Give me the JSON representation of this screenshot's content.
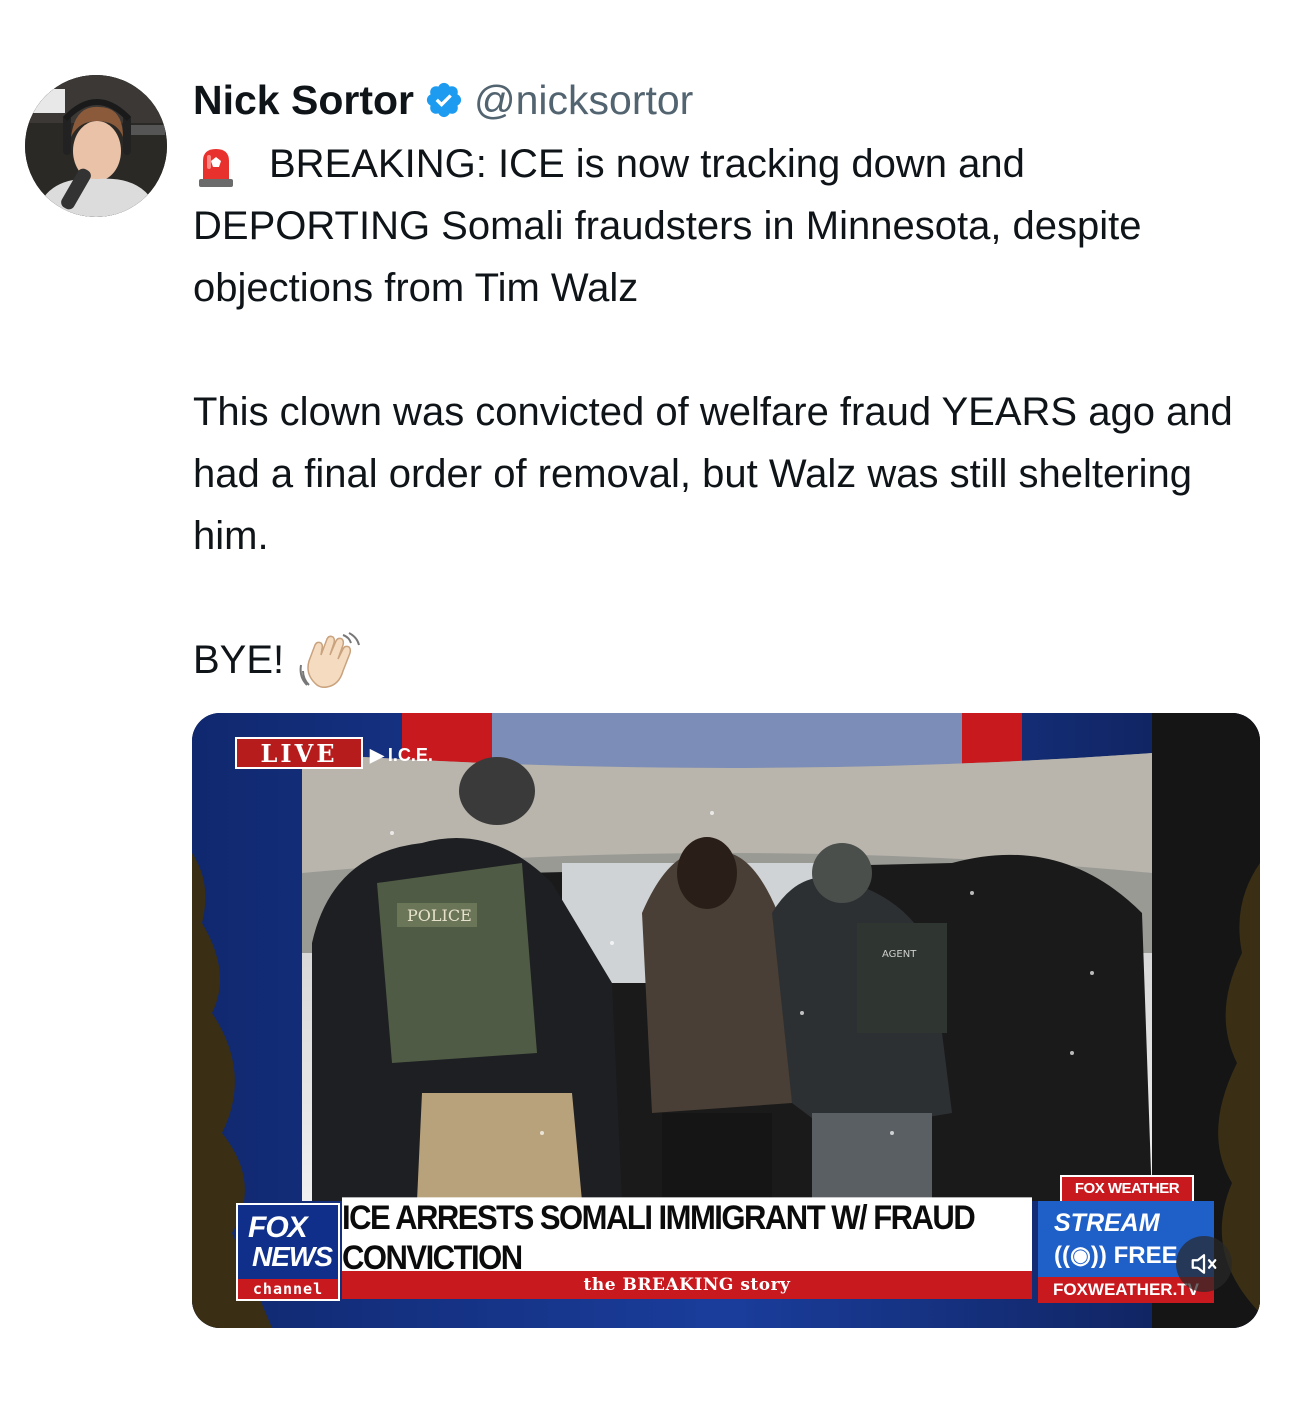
{
  "tweet": {
    "author_name": "Nick Sortor",
    "author_handle": "@nicksortor",
    "lines": [
      "BREAKING: ICE is now tracking down and DEPORTING Somali fraudsters in Minnesota, despite objections from Tim Walz",
      "This clown was convicted of welfare fraud YEARS ago and had a final order of removal, but Walz was still sheltering him.",
      "BYE!"
    ]
  },
  "video": {
    "live_label": "LIVE",
    "tag_label": "I.C.E.",
    "vest_police": "POLICE",
    "vest_agent": "AGENT",
    "chyron": "ICE ARRESTS SOMALI IMMIGRANT W/ FRAUD CONVICTION",
    "subbar": "the BREAKING story",
    "logo_fox": "FOX",
    "logo_news": "NEWS",
    "logo_channel": "channel",
    "weather_top": "FOX WEATHER",
    "weather_stream": "STREAM",
    "weather_free": "FREE",
    "weather_url": "FOXWEATHER.TV"
  },
  "colors": {
    "verified": "#1d9bf0",
    "handle": "#536471",
    "fox_red": "#c8191f",
    "fox_blue": "#0f2f8a"
  },
  "icons": [
    "siren-emoji-icon",
    "verified-badge-icon",
    "waving-hand-emoji-icon",
    "mute-icon"
  ]
}
